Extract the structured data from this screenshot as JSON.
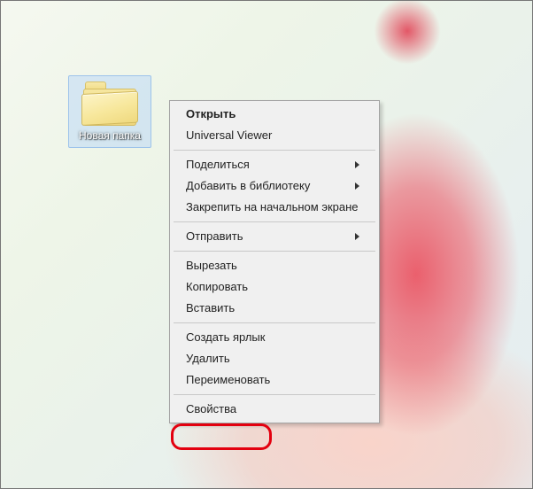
{
  "desktop": {
    "folder_label": "Новая папка"
  },
  "context_menu": {
    "groups": [
      [
        {
          "label": "Открыть",
          "bold": true,
          "submenu": false
        },
        {
          "label": "Universal Viewer",
          "bold": false,
          "submenu": false
        }
      ],
      [
        {
          "label": "Поделиться",
          "bold": false,
          "submenu": true
        },
        {
          "label": "Добавить в библиотеку",
          "bold": false,
          "submenu": true
        },
        {
          "label": "Закрепить на начальном экране",
          "bold": false,
          "submenu": false
        }
      ],
      [
        {
          "label": "Отправить",
          "bold": false,
          "submenu": true
        }
      ],
      [
        {
          "label": "Вырезать",
          "bold": false,
          "submenu": false
        },
        {
          "label": "Копировать",
          "bold": false,
          "submenu": false
        },
        {
          "label": "Вставить",
          "bold": false,
          "submenu": false
        }
      ],
      [
        {
          "label": "Создать ярлык",
          "bold": false,
          "submenu": false
        },
        {
          "label": "Удалить",
          "bold": false,
          "submenu": false
        },
        {
          "label": "Переименовать",
          "bold": false,
          "submenu": false
        }
      ],
      [
        {
          "label": "Свойства",
          "bold": false,
          "submenu": false
        }
      ]
    ]
  },
  "annotation": {
    "highlighted_item": "Свойства",
    "highlight_color": "#e3000f"
  }
}
